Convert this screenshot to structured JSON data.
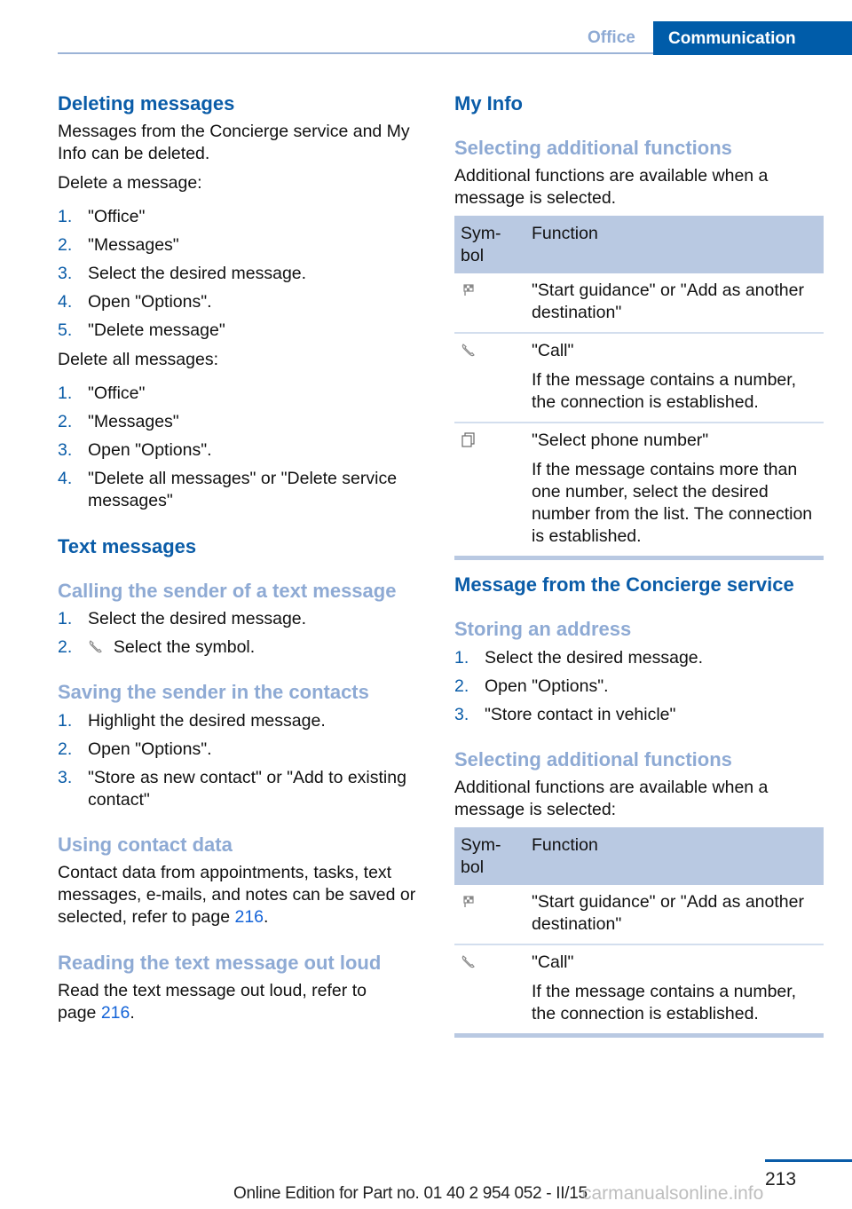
{
  "header": {
    "section": "Office",
    "chapter": "Communication"
  },
  "left": {
    "deleting": {
      "title": "Deleting messages",
      "intro": "Messages from the Concierge service and My Info can be deleted.",
      "single_label": "Delete a message:",
      "single_steps": [
        "\"Office\"",
        "\"Messages\"",
        "Select the desired message.",
        "Open \"Options\".",
        "\"Delete message\""
      ],
      "all_label": "Delete all messages:",
      "all_steps": [
        "\"Office\"",
        "\"Messages\"",
        "Open \"Options\".",
        "\"Delete all messages\" or \"Delete service messages\""
      ]
    },
    "text_messages": {
      "title": "Text messages",
      "calling": {
        "title": "Calling the sender of a text message",
        "steps": [
          "Select the desired message.",
          "Select the symbol."
        ],
        "step2_icon": "phone-handset-icon"
      },
      "saving": {
        "title": "Saving the sender in the contacts",
        "steps": [
          "Highlight the desired message.",
          "Open \"Options\".",
          "\"Store as new contact\" or \"Add to existing contact\""
        ]
      },
      "contact_data": {
        "title": "Using contact data",
        "text": "Contact data from appointments, tasks, text messages, e-mails, and notes can be saved or selected, refer to page ",
        "page": "216",
        "end": "."
      },
      "reading": {
        "title": "Reading the text message out loud",
        "text": "Read the text message out loud, refer to page ",
        "page": "216",
        "end": "."
      }
    }
  },
  "right": {
    "my_info": {
      "title": "My Info",
      "sub_title": "Selecting additional functions",
      "intro": "Additional functions are available when a message is selected.",
      "table": {
        "headers": [
          "Sym-bol",
          "Function"
        ],
        "rows": [
          {
            "icon": "destination-flag-icon",
            "function": "\"Start guidance\" or \"Add as another destination\"",
            "detail": ""
          },
          {
            "icon": "phone-handset-icon",
            "function": "\"Call\"",
            "detail": "If the message contains a number, the connection is established."
          },
          {
            "icon": "select-number-icon",
            "function": "\"Select phone number\"",
            "detail": "If the message contains more than one number, select the desired number from the list. The connection is established."
          }
        ]
      }
    },
    "concierge": {
      "title": "Message from the Concierge service",
      "storing": {
        "title": "Storing an address",
        "steps": [
          "Select the desired message.",
          "Open \"Options\".",
          "\"Store contact in vehicle\""
        ]
      },
      "additional": {
        "title": "Selecting additional functions",
        "intro": "Additional functions are available when a message is selected:",
        "table": {
          "headers": [
            "Sym-bol",
            "Function"
          ],
          "rows": [
            {
              "icon": "destination-flag-icon",
              "function": "\"Start guidance\" or \"Add as another destination\"",
              "detail": ""
            },
            {
              "icon": "phone-handset-icon",
              "function": "\"Call\"",
              "detail": "If the message contains a number, the connection is established."
            }
          ]
        }
      }
    }
  },
  "footer": {
    "page_number": "213",
    "edition": "Online Edition for Part no. 01 40 2 954 052 - II/15",
    "watermark": "carmanualsonline.info"
  }
}
